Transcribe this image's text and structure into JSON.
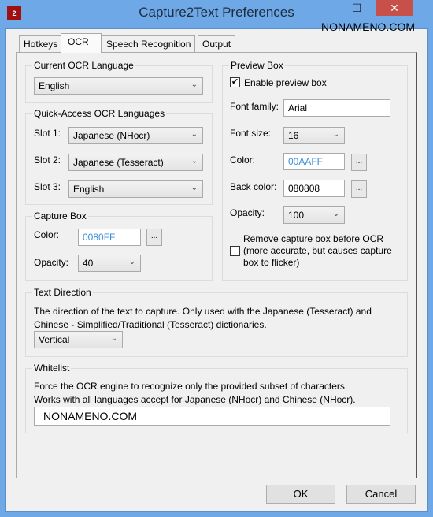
{
  "window": {
    "title": "Capture2Text Preferences",
    "watermark": "NONAMENO.COM",
    "icon": "app-icon",
    "minimize": "–",
    "maximize": "☐",
    "close": "✕"
  },
  "tabs": [
    {
      "label": "Hotkeys"
    },
    {
      "label": "OCR",
      "active": true
    },
    {
      "label": "Speech Recognition"
    },
    {
      "label": "Output"
    }
  ],
  "current_lang": {
    "label": "Current OCR Language",
    "value": "English"
  },
  "quick": {
    "label": "Quick-Access OCR Languages",
    "slots": [
      {
        "label": "Slot 1:",
        "value": "Japanese (NHocr)"
      },
      {
        "label": "Slot 2:",
        "value": "Japanese (Tesseract)"
      },
      {
        "label": "Slot 3:",
        "value": "English"
      }
    ]
  },
  "capture": {
    "label": "Capture Box",
    "color_label": "Color:",
    "color": "0080FF",
    "opacity_label": "Opacity:",
    "opacity": "40",
    "pick": "..."
  },
  "preview": {
    "label": "Preview Box",
    "enable_label": "Enable preview box",
    "enable": true,
    "font_family_label": "Font family:",
    "font_family": "Arial",
    "font_size_label": "Font size:",
    "font_size": "16",
    "color_label": "Color:",
    "color": "00AAFF",
    "back_label": "Back color:",
    "back": "080808",
    "opacity_label": "Opacity:",
    "opacity": "100",
    "remove_label": "Remove capture box before OCR (more accurate, but causes capture box to flicker)",
    "remove": false,
    "pick": "..."
  },
  "direction": {
    "label": "Text Direction",
    "desc": "The direction of the text to capture. Only used with the Japanese (Tesseract) and Chinese - Simplified/Traditional (Tesseract) dictionaries.",
    "value": "Vertical"
  },
  "whitelist": {
    "label": "Whitelist",
    "desc1": "Force the OCR engine to recognize only the provided subset of characters.",
    "desc2": "Works with all languages accept for Japanese (NHocr) and Chinese (NHocr).",
    "value": "NONAMENO.COM"
  },
  "buttons": {
    "ok": "OK",
    "cancel": "Cancel"
  },
  "colors": {
    "titlebar": "#6fa8e6",
    "close": "#c7504a",
    "blue_text": "#3a8fd8"
  }
}
